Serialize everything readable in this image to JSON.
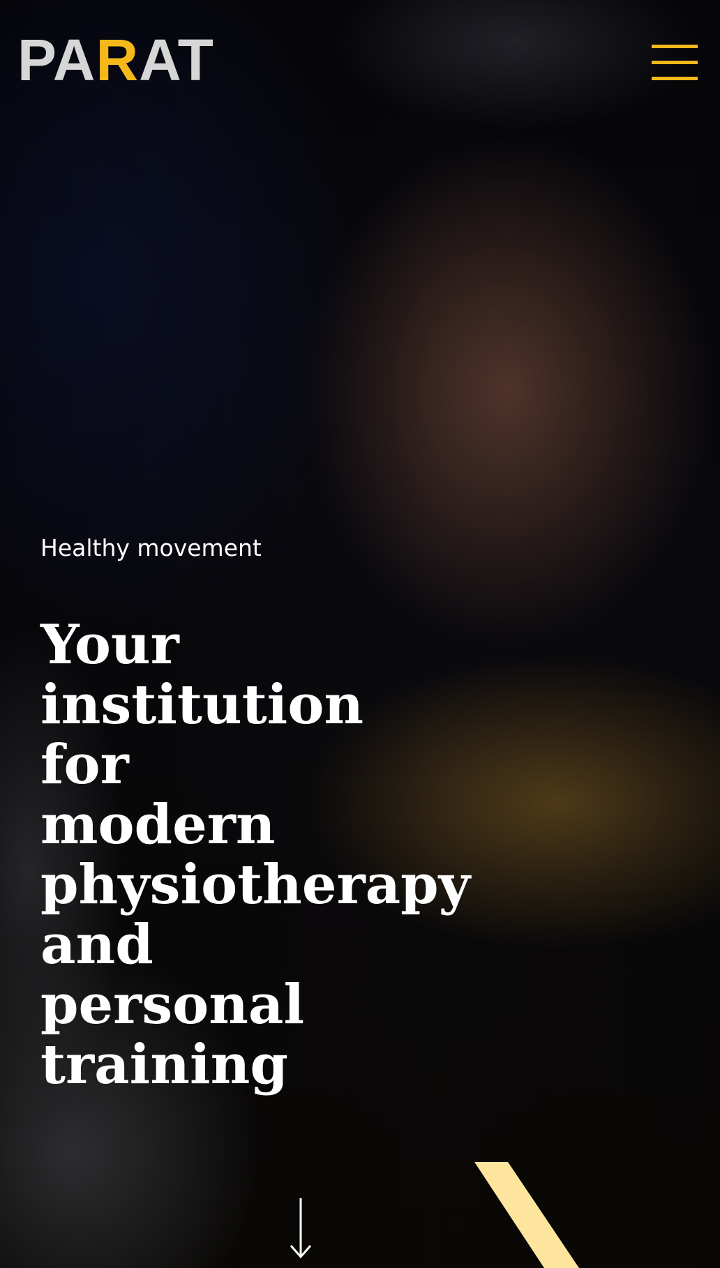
{
  "header": {
    "logo": {
      "text_before": "PA",
      "accent_letter": "R",
      "text_after": "AT",
      "accent_color": "#f5b81a"
    },
    "menu_icon": "hamburger-menu-icon"
  },
  "hero": {
    "eyebrow": "Healthy movement",
    "headline_lines": [
      "Your",
      "institution",
      "for",
      "modern",
      "physiotherapy",
      "and",
      "personal",
      "training"
    ],
    "scroll_icon": "arrow-down-icon",
    "stripe_color": "#fde59e"
  },
  "colors": {
    "accent": "#f5b81a",
    "text": "#ffffff"
  }
}
